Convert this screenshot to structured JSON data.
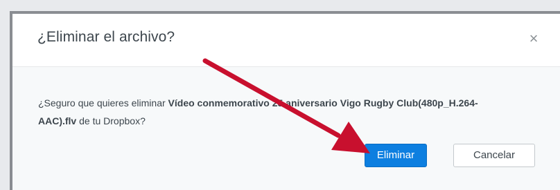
{
  "dialog": {
    "title": "¿Eliminar el archivo?",
    "close_icon": "close-icon",
    "close_glyph": "×",
    "message_prefix": "¿Seguro que quieres eliminar ",
    "file_name": "Vídeo conmemorativo 25 aniversario Vigo Rugby Club(480p_H.264-AAC).flv",
    "message_suffix": " de tu Dropbox?",
    "confirm_label": "Eliminar",
    "cancel_label": "Cancelar"
  },
  "annotation": {
    "arrow_color": "#c8102e"
  },
  "colors": {
    "primary": "#0d7fe0",
    "title_text": "#3d464d",
    "body_background": "#f7f9fa"
  }
}
